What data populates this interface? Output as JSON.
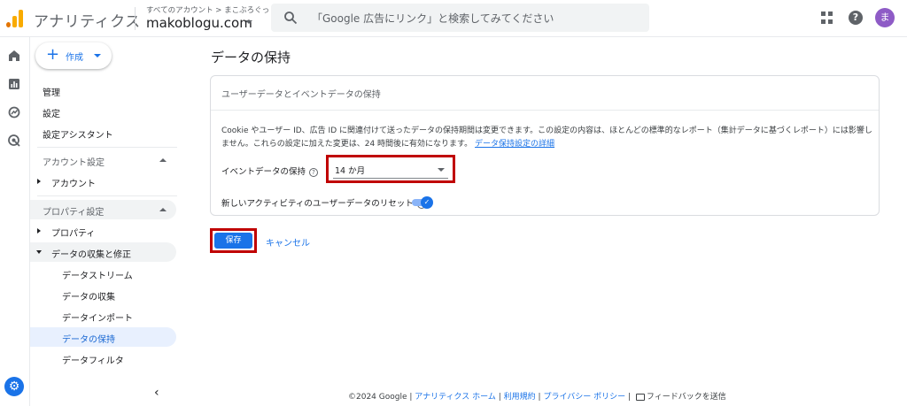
{
  "header": {
    "app_name": "アナリティクス",
    "account_path": "すべてのアカウント > まこぶろぐっ",
    "property_name": "makoblogu.com",
    "search_placeholder": "「Google 広告にリンク」と検索してみてください",
    "avatar_initial": "ま",
    "help_label": "?"
  },
  "sidebar": {
    "create_label": "作成",
    "items_top": [
      "管理",
      "設定",
      "設定アシスタント"
    ],
    "account_section": "アカウント設定",
    "account_item": "アカウント",
    "property_section": "プロパティ設定",
    "property_item": "プロパティ",
    "data_collection": "データの収集と修正",
    "sub_items": [
      "データストリーム",
      "データの収集",
      "データインポート",
      "データの保持",
      "データフィルタ"
    ],
    "active_item": "データの保持"
  },
  "main": {
    "page_title": "データの保持",
    "card_title": "ユーザーデータとイベントデータの保持",
    "description": "Cookie やユーザー ID、広告 ID に関連付けて送ったデータの保持期間は変更できます。この設定の内容は、ほとんどの標準的なレポート（集計データに基づくレポート）には影響しません。これらの設定に加えた変更は、24 時間後に有効になります。",
    "description_link": "データ保持設定の詳細",
    "event_retention_label": "イベントデータの保持",
    "event_retention_value": "14 か月",
    "reset_label": "新しいアクティビティのユーザーデータのリセット",
    "reset_enabled": true,
    "save_label": "保存",
    "cancel_label": "キャンセル"
  },
  "footer": {
    "copyright": "©2024 Google",
    "links": [
      "アナリティクス ホーム",
      "利用規約",
      "プライバシー ポリシー"
    ],
    "feedback": "フィードバックを送信"
  },
  "colors": {
    "accent": "#1a73e8",
    "highlight_border": "#c00000",
    "active_nav_bg": "#e8f0fe"
  },
  "icons": {
    "rail": [
      "home-icon",
      "reports-icon",
      "explore-icon",
      "advertising-icon",
      "settings-icon"
    ],
    "header": [
      "search-icon",
      "apps-grid-icon",
      "help-icon"
    ]
  }
}
